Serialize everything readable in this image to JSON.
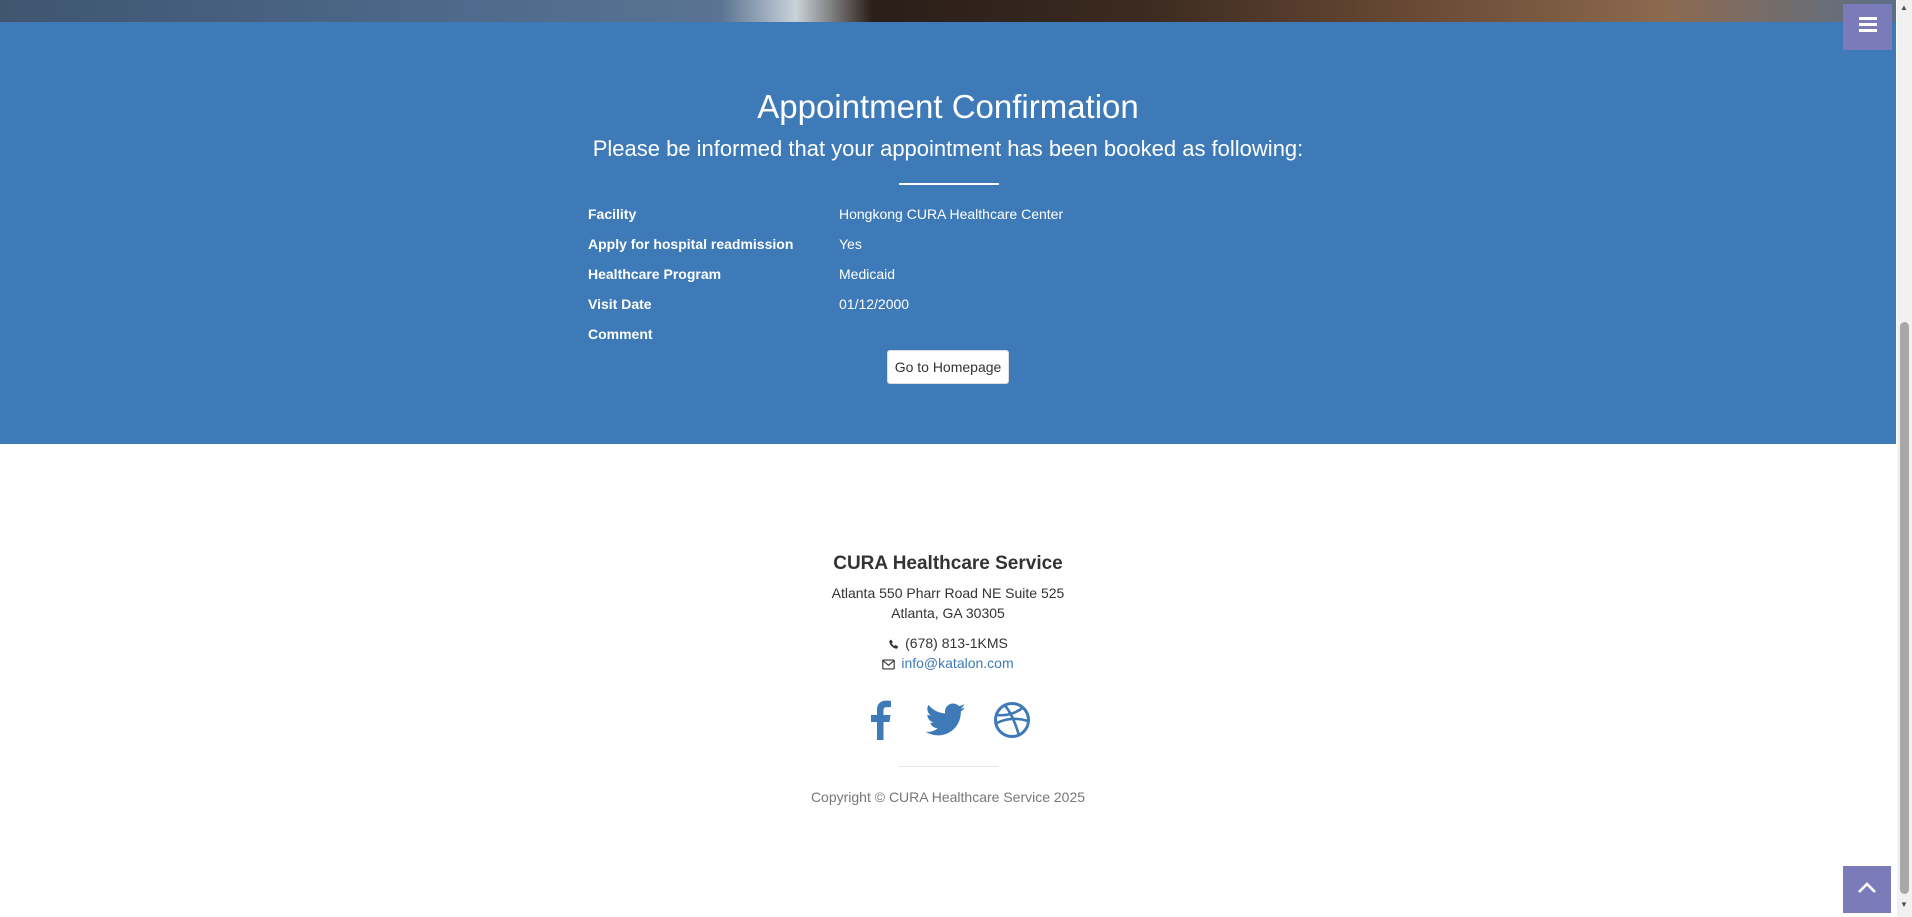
{
  "confirmation": {
    "title": "Appointment Confirmation",
    "subtitle": "Please be informed that your appointment has been booked as following:",
    "details": [
      {
        "label": "Facility",
        "value": "Hongkong CURA Healthcare Center"
      },
      {
        "label": "Apply for hospital readmission",
        "value": "Yes"
      },
      {
        "label": "Healthcare Program",
        "value": "Medicaid"
      },
      {
        "label": "Visit Date",
        "value": "01/12/2000"
      },
      {
        "label": "Comment",
        "value": ""
      }
    ],
    "home_button_label": "Go to Homepage",
    "background_color": "#3d7ab7"
  },
  "footer": {
    "title": "CURA Healthcare Service",
    "address_line1": "Atlanta 550 Pharr Road NE Suite 525",
    "address_line2": "Atlanta, GA 30305",
    "phone": "(678) 813-1KMS",
    "email": "info@katalon.com",
    "social": [
      "facebook-icon",
      "twitter-icon",
      "dribbble-icon"
    ],
    "copyright": "Copyright © CURA Healthcare Service 2025"
  },
  "widgets": {
    "menu_icon": "menu-icon",
    "to_top_icon": "chevron-up-icon",
    "accent_color": "#7a7bb8"
  }
}
